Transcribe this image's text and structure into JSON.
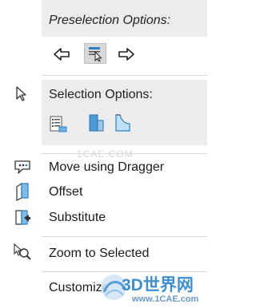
{
  "preselection": {
    "title": "Preselection Options:"
  },
  "selection": {
    "title": "Selection Options:"
  },
  "nav": {
    "back_icon": "arrow-left-icon",
    "cursor_icon": "select-cursor-icon",
    "forward_icon": "arrow-right-icon"
  },
  "selection_icons": [
    "list-select-icon",
    "face-select-icon",
    "surface-select-icon"
  ],
  "menu_items": [
    {
      "label": "Move using Dragger",
      "icon": "dragger-icon"
    },
    {
      "label": "Offset",
      "icon": "offset-icon"
    },
    {
      "label": "Substitute",
      "icon": "substitute-icon"
    },
    {
      "label": "Zoom to Selected",
      "icon": "zoom-selected-icon"
    },
    {
      "label": "Customize",
      "icon": ""
    }
  ],
  "watermark": {
    "center": "1CAE.COM",
    "brand": "3D世界网",
    "url": "www.1CAE.com"
  },
  "colors": {
    "accent_blue": "#2e7fc2",
    "band_gray": "#ececec"
  }
}
